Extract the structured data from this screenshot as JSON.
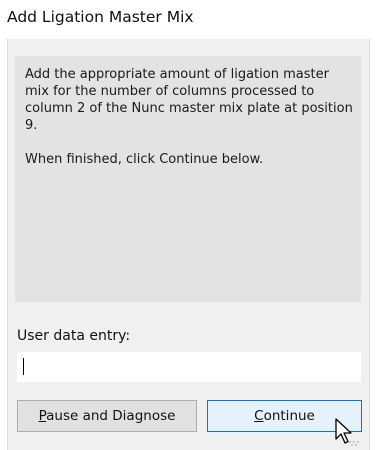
{
  "window": {
    "title": "Add Ligation Master Mix"
  },
  "instructions": {
    "paragraph1": "Add the appropriate amount of ligation master mix for the number of columns processed to column 2 of the Nunc master mix plate at position 9.",
    "paragraph2": "When finished, click Continue below."
  },
  "entry": {
    "label": "User data entry:",
    "value": ""
  },
  "buttons": {
    "pause": {
      "mnemonic": "P",
      "rest": "ause and Diagnose"
    },
    "continue": {
      "mnemonic": "C",
      "rest": "ontinue"
    }
  },
  "colors": {
    "panel": "#e3e3e3",
    "dialog": "#f0f0f0",
    "continue_focus_border": "#0078d7",
    "continue_focus_fill": "#e5f1fb"
  },
  "icons": {
    "mouse_cursor": "cursor-arrow-icon"
  }
}
